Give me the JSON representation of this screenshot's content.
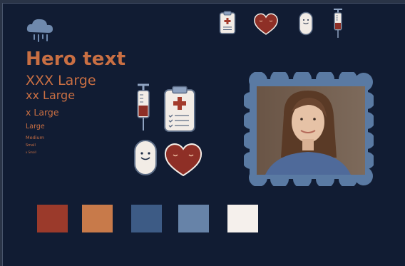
{
  "typography": {
    "hero": "Hero text",
    "xxx_large": "XXX Large",
    "xx_large": "xx Large",
    "x_large": "x Large",
    "large": "Large",
    "medium": "Medium",
    "small": "Small",
    "x_small": "x Small"
  },
  "icons": [
    "rain-cloud-icon",
    "clipboard-icon",
    "heart-icon",
    "pill-icon",
    "syringe-icon"
  ],
  "palette": {
    "background": "#111c33",
    "swatches": [
      "#9b3a2b",
      "#c87a4a",
      "#3d5b85",
      "#6783a8",
      "#f5f0ec"
    ]
  },
  "photo": {
    "frame_color": "#5a7aa3"
  }
}
